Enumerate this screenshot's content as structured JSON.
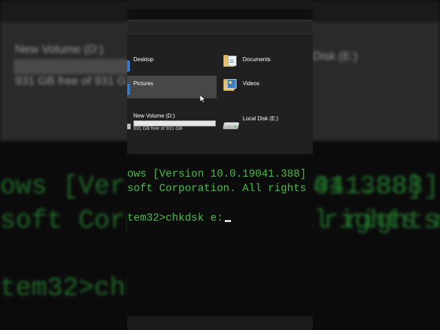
{
  "explorer": {
    "folders": [
      {
        "label": "Desktop"
      },
      {
        "label": "Documents"
      },
      {
        "label": "Pictures"
      },
      {
        "label": "Videos"
      }
    ],
    "drives": [
      {
        "label": "New Volume (D:)",
        "detail": "931 GB free of 931 GB",
        "used_fraction": 0.0
      },
      {
        "label": "Local Disk (E:)"
      }
    ]
  },
  "background": {
    "drive_label": "New Volume (D:)",
    "drive_detail": "931 GB free of 931 G",
    "drive2_label": "Disk (E:)",
    "cmd_line1": "ows [Version 10.0.19041.388]",
    "cmd_line1_right": "41.388]",
    "cmd_line2": "soft Corporation. All rights r",
    "cmd_line2_right": "rights r",
    "cmd_line3": "tem32>chk"
  },
  "cmd": {
    "lines": [
      "ows [Version 10.0.19041.388]",
      "soft Corporation. All rights r"
    ],
    "prompt": "tem32>chkdsk e:"
  },
  "colors": {
    "cmd_text": "#3fbf3a",
    "selection": "#474747",
    "capacity_fill": "#26a0da"
  }
}
